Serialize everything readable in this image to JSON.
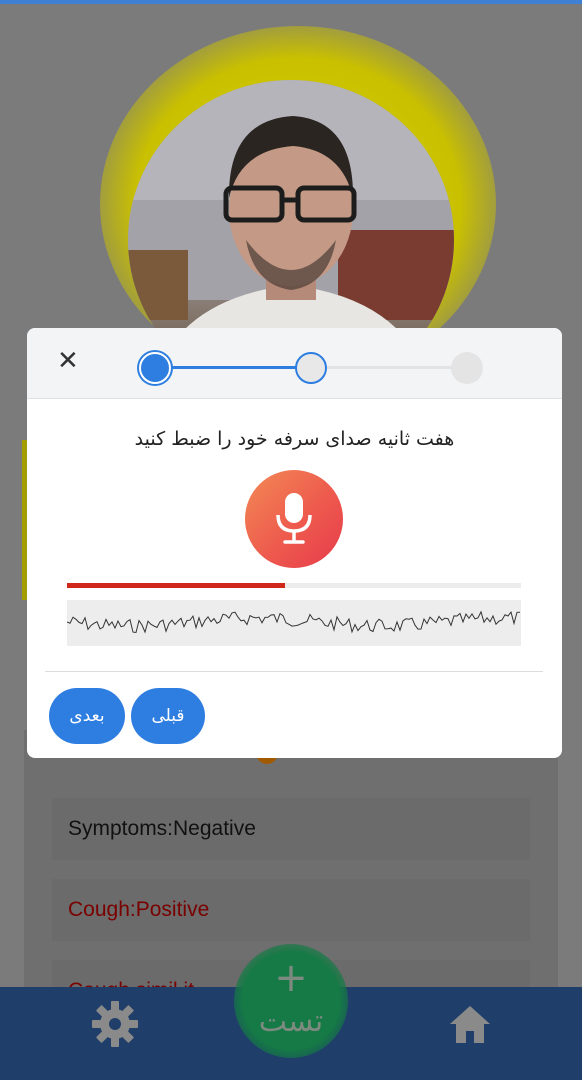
{
  "modal": {
    "instruction": "هفت ثانیه صدای سرفه خود را ضبط کنید",
    "close_symbol": "✕",
    "steps_total": 3,
    "current_step": 2,
    "recording_progress": 0.48,
    "next_label": "بعدی",
    "previous_label": "قبلی"
  },
  "results": {
    "rows": [
      "Symptoms:Negative",
      "Cough:Positive",
      "Cough simil it..."
    ]
  },
  "bottom_nav": {
    "fab_plus": "+",
    "fab_label": "تست",
    "settings_icon": "gear-icon",
    "home_icon": "home-icon"
  },
  "colors": {
    "accent": "#2d7ee0",
    "progress": "#d0271a",
    "fab": "#157a45",
    "nav": "#1f3f6a",
    "halo": "#d8d000"
  }
}
